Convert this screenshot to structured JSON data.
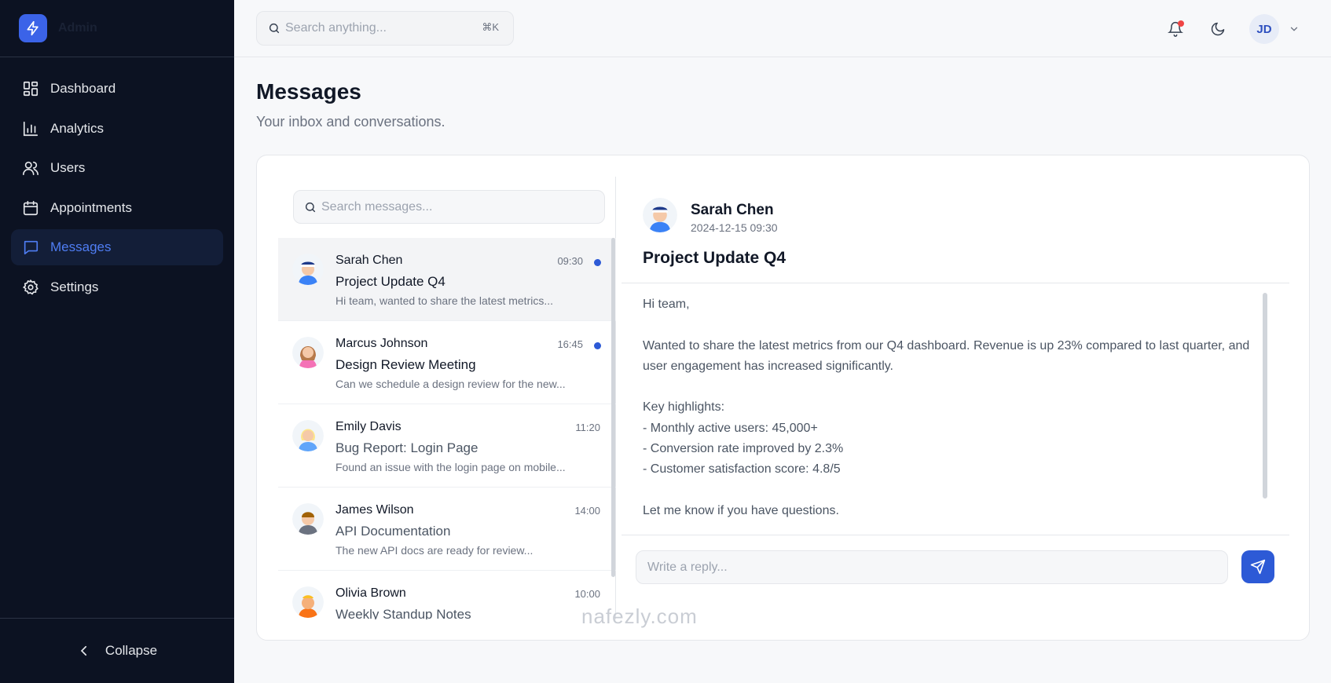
{
  "sidebar": {
    "brand": "Admin",
    "items": [
      {
        "label": "Dashboard",
        "icon": "dashboard-icon",
        "active": false
      },
      {
        "label": "Analytics",
        "icon": "analytics-icon",
        "active": false
      },
      {
        "label": "Users",
        "icon": "users-icon",
        "active": false
      },
      {
        "label": "Appointments",
        "icon": "calendar-icon",
        "active": false
      },
      {
        "label": "Messages",
        "icon": "message-icon",
        "active": true
      },
      {
        "label": "Settings",
        "icon": "gear-icon",
        "active": false
      }
    ],
    "collapse_label": "Collapse"
  },
  "topbar": {
    "search_placeholder": "Search anything...",
    "shortcut": "⌘K",
    "user_initials": "JD"
  },
  "page": {
    "title": "Messages",
    "subtitle": "Your inbox and conversations."
  },
  "inbox": {
    "search_placeholder": "Search messages...",
    "messages": [
      {
        "sender": "Sarah Chen",
        "time": "09:30",
        "subject": "Project Update Q4",
        "preview": "Hi team, wanted to share the latest metrics...",
        "unread": true
      },
      {
        "sender": "Marcus Johnson",
        "time": "16:45",
        "subject": "Design Review Meeting",
        "preview": "Can we schedule a design review for the new...",
        "unread": true
      },
      {
        "sender": "Emily Davis",
        "time": "11:20",
        "subject": "Bug Report: Login Page",
        "preview": "Found an issue with the login page on mobile...",
        "unread": false
      },
      {
        "sender": "James Wilson",
        "time": "14:00",
        "subject": "API Documentation",
        "preview": "The new API docs are ready for review...",
        "unread": false
      },
      {
        "sender": "Olivia Brown",
        "time": "10:00",
        "subject": "Weekly Standup Notes",
        "preview": "",
        "unread": false
      }
    ]
  },
  "detail": {
    "sender": "Sarah Chen",
    "date": "2024-12-15 09:30",
    "subject": "Project Update Q4",
    "body": {
      "greeting": "Hi team,",
      "para1": "Wanted to share the latest metrics from our Q4 dashboard. Revenue is up 23% compared to last quarter, and user engagement has increased significantly.",
      "highlights_title": "Key highlights:",
      "h1": "- Monthly active users: 45,000+",
      "h2": "- Conversion rate improved by 2.3%",
      "h3": "- Customer satisfaction score: 4.8/5",
      "closing": "Let me know if you have questions."
    },
    "reply_placeholder": "Write a reply..."
  },
  "watermark": "nafezly.com",
  "colors": {
    "accent": "#2d5ad6",
    "sidebar_bg": "#0c1222",
    "unread_dot": "#2d5ad6",
    "notif_dot": "#ef4444"
  }
}
